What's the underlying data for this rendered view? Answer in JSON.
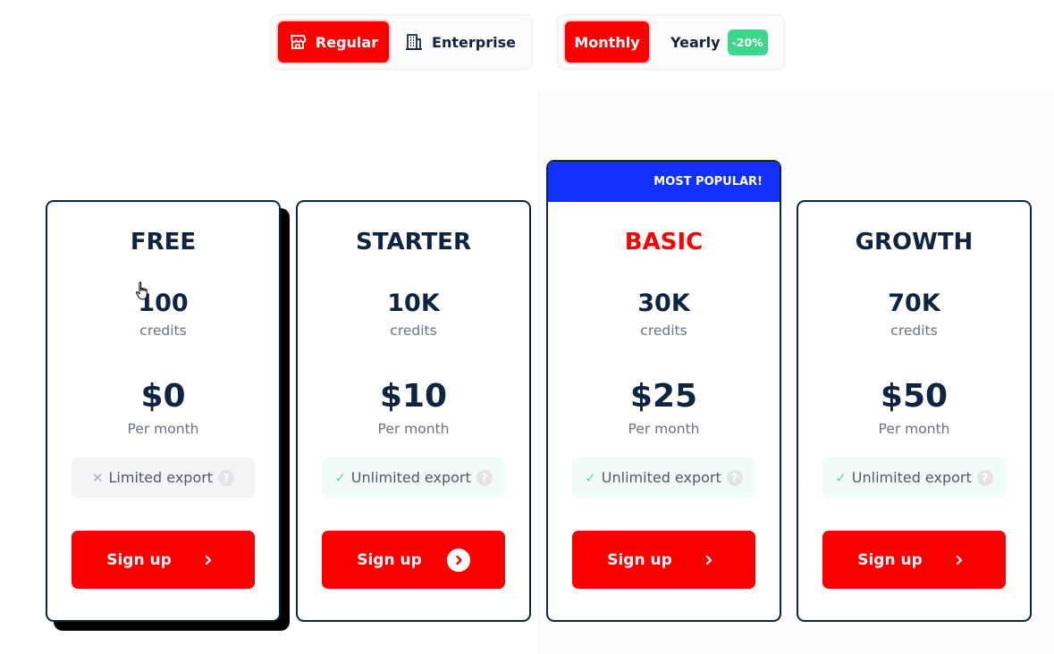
{
  "toggles": {
    "type": {
      "regular": {
        "label": "Regular",
        "icon": "store-icon",
        "active": true
      },
      "enterprise": {
        "label": "Enterprise",
        "icon": "building-icon",
        "active": false
      }
    },
    "period": {
      "monthly": {
        "label": "Monthly",
        "active": true
      },
      "yearly": {
        "label": "Yearly",
        "badge": "-20%",
        "active": false
      }
    }
  },
  "plans": [
    {
      "name": "FREE",
      "credits": "100",
      "credits_unit": "credits",
      "price": "$0",
      "period": "Per month",
      "feature": "Limited export",
      "feature_included": false,
      "cta": "Sign up"
    },
    {
      "name": "STARTER",
      "credits": "10K",
      "credits_unit": "credits",
      "price": "$10",
      "period": "Per month",
      "feature": "Unlimited export",
      "feature_included": true,
      "cta": "Sign up"
    },
    {
      "name": "BASIC",
      "badge": "MOST POPULAR!",
      "credits": "30K",
      "credits_unit": "credits",
      "price": "$25",
      "period": "Per month",
      "feature": "Unlimited export",
      "feature_included": true,
      "cta": "Sign up"
    },
    {
      "name": "GROWTH",
      "credits": "70K",
      "credits_unit": "credits",
      "price": "$50",
      "period": "Per month",
      "feature": "Unlimited export",
      "feature_included": true,
      "cta": "Sign up"
    }
  ],
  "colors": {
    "accent": "#fb0000",
    "text": "#0f2440",
    "ribbon": "#1330ff",
    "discount": "#3bd88c",
    "check": "#5fd39c"
  }
}
